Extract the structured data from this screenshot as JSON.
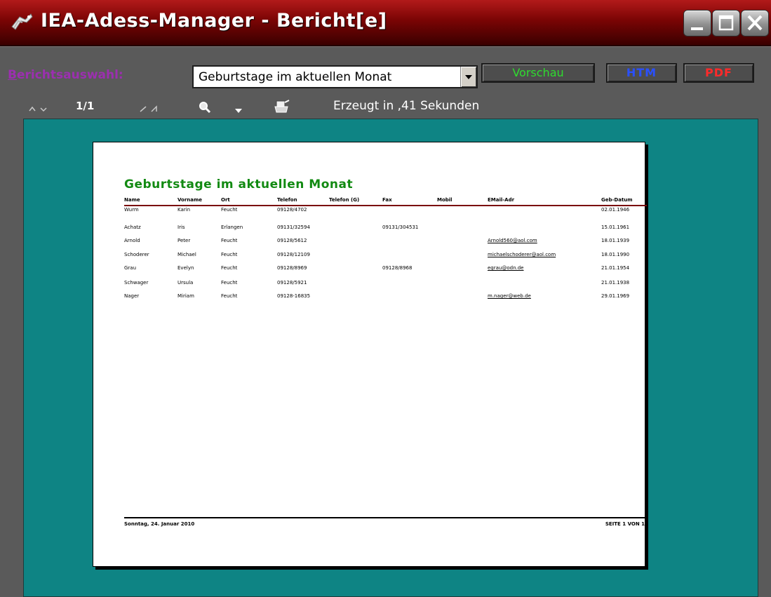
{
  "window": {
    "title": "IEA-Adess-Manager - Bericht[e]"
  },
  "toolbar": {
    "auswahl_label_first": "B",
    "auswahl_label_rest": "erichtsauswahl:",
    "report_select_value": "Geburtstage im aktuellen Monat",
    "vorschau_label": "Vorschau",
    "htm_label": "HTM",
    "pdf_label": "PDF",
    "page_indicator": "1/1",
    "status_text": "Erzeugt in ,41 Sekunden",
    "icons": [
      "first-page-icon",
      "previous-page-icon",
      "next-page-icon",
      "last-page-icon",
      "zoom-icon",
      "zoom-dropdown-icon",
      "print-icon"
    ]
  },
  "report": {
    "title": "Geburtstage im aktuellen Monat",
    "columns": [
      "Name",
      "Vorname",
      "Ort",
      "Telefon",
      "Telefon (G)",
      "Fax",
      "Mobil",
      "EMail-Adr",
      "Geb-Datum"
    ],
    "rows": [
      {
        "name": "Wurm",
        "vorname": "Karin",
        "ort": "Feucht",
        "telefon": "09128/4702",
        "telefon_g": "",
        "fax": "",
        "mobil": "",
        "email": "",
        "geb": "02.01.1946"
      },
      {
        "name": "Achatz",
        "vorname": "Iris",
        "ort": "Erlangen",
        "telefon": "09131/32594",
        "telefon_g": "",
        "fax": "09131/304531",
        "mobil": "",
        "email": "",
        "geb": "15.01.1961"
      },
      {
        "name": "Arnold",
        "vorname": "Peter",
        "ort": "Feucht",
        "telefon": "09128/5612",
        "telefon_g": "",
        "fax": "",
        "mobil": "",
        "email": "Arnold560@aol.com",
        "geb": "18.01.1939"
      },
      {
        "name": "Schoderer",
        "vorname": "Michael",
        "ort": "Feucht",
        "telefon": "09128/12109",
        "telefon_g": "",
        "fax": "",
        "mobil": "",
        "email": "michaelschoderer@aol.com",
        "geb": "18.01.1990"
      },
      {
        "name": "Grau",
        "vorname": "Evelyn",
        "ort": "Feucht",
        "telefon": "09128/8969",
        "telefon_g": "",
        "fax": "09128/8968",
        "mobil": "",
        "email": "egrau@odn.de",
        "geb": "21.01.1954"
      },
      {
        "name": "Schwager",
        "vorname": "Ursula",
        "ort": "Feucht",
        "telefon": "09128/5921",
        "telefon_g": "",
        "fax": "",
        "mobil": "",
        "email": "",
        "geb": "21.01.1938"
      },
      {
        "name": "Nager",
        "vorname": "Miriam",
        "ort": "Feucht",
        "telefon": "09128-16835",
        "telefon_g": "",
        "fax": "",
        "mobil": "",
        "email": "m.nager@web.de",
        "geb": "29.01.1969"
      }
    ],
    "footer_date": "Sonntag, 24. Januar 2010",
    "footer_page": "SEITE 1 VON 1"
  },
  "colors": {
    "title_bar": "#8a0a0a",
    "report_title": "#128a12",
    "viewer_bg": "#0e8484",
    "vorschau": "#2fdc2f",
    "htm": "#2a50ff",
    "pdf": "#ff2a2a",
    "auswahl_label": "#9c2fb0"
  }
}
